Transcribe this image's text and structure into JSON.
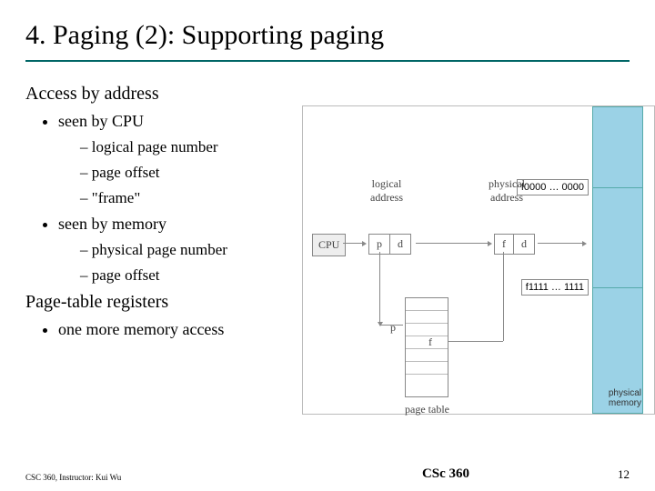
{
  "title": "4. Paging (2): Supporting paging",
  "sections": {
    "access": {
      "heading": "Access by address",
      "cpu": {
        "label": "seen by CPU",
        "items": [
          "logical page number",
          "page offset",
          "\"frame\""
        ]
      },
      "memory": {
        "label": "seen by memory",
        "items": [
          "physical page number",
          "page offset"
        ]
      }
    },
    "registers": {
      "heading": "Page-table registers",
      "items": [
        "one more memory access"
      ]
    }
  },
  "diagram": {
    "cpu": "CPU",
    "p": "p",
    "d": "d",
    "f": "f",
    "logical_address_label": "logical\naddress",
    "physical_address_label": "physical\naddress",
    "page_table_label": "page table",
    "physical_memory_label": "physical\nmemory",
    "mem_top": "f0000 … 0000",
    "mem_bottom": "f1111 … 1111"
  },
  "footer": {
    "left": "CSC 360, Instructor: Kui Wu",
    "center": "CSc 360",
    "page_number": "12"
  }
}
